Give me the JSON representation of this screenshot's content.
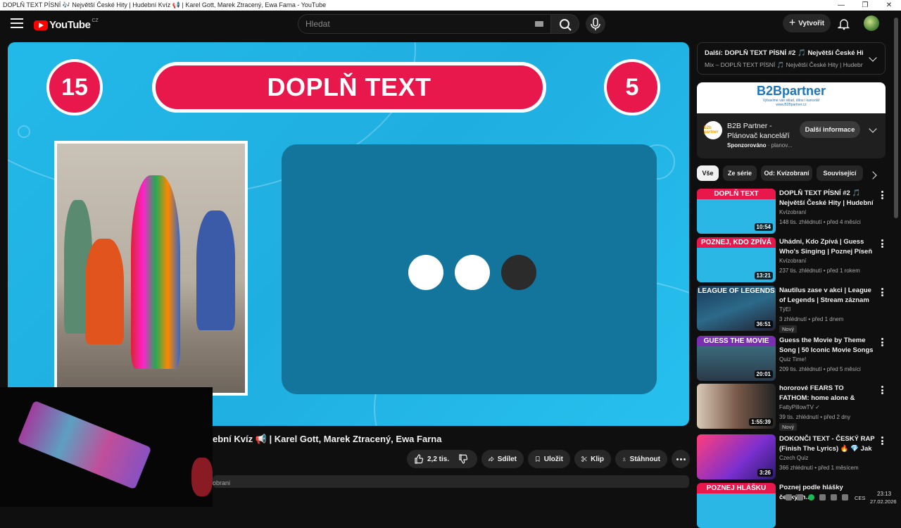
{
  "window": {
    "title": "DOPLŇ TEXT PÍSNÍ 🎶 Největší České Hity | Hudební Kvíz 📢 | Karel Gott, Marek Ztracený, Ewa Farna - YouTube",
    "controls": [
      "—",
      "❐",
      "✕"
    ]
  },
  "header": {
    "logo": "YouTube",
    "region": "CZ",
    "search_placeholder": "Hledat",
    "create_label": "Vytvořit"
  },
  "player": {
    "left_number": "15",
    "banner": "DOPLŇ TEXT",
    "right_number": "5",
    "dot_colors": [
      "#ffffff",
      "#ffffff",
      "#2b2b2b"
    ]
  },
  "video": {
    "title_visible": "ební Kvíz 📢 | Karel Gott, Marek Ztracený, Ewa Farna",
    "like_count": "2,2 tis.",
    "share": "Sdílet",
    "save": "Uložit",
    "clip": "Klip",
    "download": "Stáhnout",
    "desc_visible": "obrani"
  },
  "next_up": {
    "line1": "Další: DOPLŇ TEXT PÍSNÍ #2 🎵 Největší České Hit...",
    "line2": "Mix – DOPLŇ TEXT PÍSNÍ 🎵 Největší České Hity | Hudební ..."
  },
  "ad": {
    "brand": "B2Bpartner",
    "tagline": "Vybavíme váš sklad, dílnu i kancelář",
    "site": "www.B2Bpartner.cz",
    "logo_text": "b2b partner",
    "name": "B2B Partner - Plánovač kanceláří",
    "sponsored": "Sponzorováno",
    "domain": " · planov...",
    "cta": "Další informace"
  },
  "chips": [
    "Vše",
    "Ze série",
    "Od: Kvízobraní",
    "Související"
  ],
  "recommendations": [
    {
      "title": "DOPLŇ TEXT PÍSNÍ #2 🎵 Největší České Hity | Hudební ...",
      "channel": "Kvízobraní",
      "meta": "148 tis. zhlédnutí • před 4 měsíci",
      "duration": "10:54",
      "thumb_text": "DOPLŇ TEXT",
      "badge": ""
    },
    {
      "title": "Uhádni, Kdo Zpívá | Guess Who's Singing | Poznej Píseň | ...",
      "channel": "Kvízobraní",
      "meta": "237 tis. zhlédnutí • před 1 rokem",
      "duration": "13:21",
      "thumb_text": "POZNEJ, KDO ZPÍVÁ",
      "badge": ""
    },
    {
      "title": "Nautilus zase v akci | League of Legends | Stream záznam",
      "channel": "TýEl",
      "meta": "3 zhlédnutí • před 1 dnem",
      "duration": "36:51",
      "thumb_text": "LEAGUE OF LEGENDS",
      "badge": "Nový"
    },
    {
      "title": "Guess the Movie by Theme Song | 50 Iconic Movie Songs ...",
      "channel": "Quiz Time!",
      "meta": "209 tis. zhlédnutí • před 5 měsíci",
      "duration": "20:01",
      "thumb_text": "GUESS THE MOVIE",
      "badge": ""
    },
    {
      "title": "hororové FEARS TO FATHOM: home alone & norwood ...",
      "channel": "FattyPillowTV ✓",
      "meta": "39 tis. zhlédnutí • před 2 dny",
      "duration": "1:55:39",
      "thumb_text": "",
      "badge": "Nový"
    },
    {
      "title": "DOKONČI TEXT - ČESKÝ RAP (Finish The Lyrics) 🔥 💎 Jak ...",
      "channel": "Czech Quiz",
      "meta": "366 zhlédnutí • před 1 měsícem",
      "duration": "3:26",
      "thumb_text": "",
      "badge": ""
    },
    {
      "title": "Poznej podle hlášky českých...",
      "channel": "",
      "meta": "",
      "duration": "",
      "thumb_text": "POZNEJ HLÁŠKU",
      "badge": ""
    }
  ],
  "taskbar": {
    "lang": "CES",
    "time": "23:13",
    "date": "27.02.2026"
  }
}
